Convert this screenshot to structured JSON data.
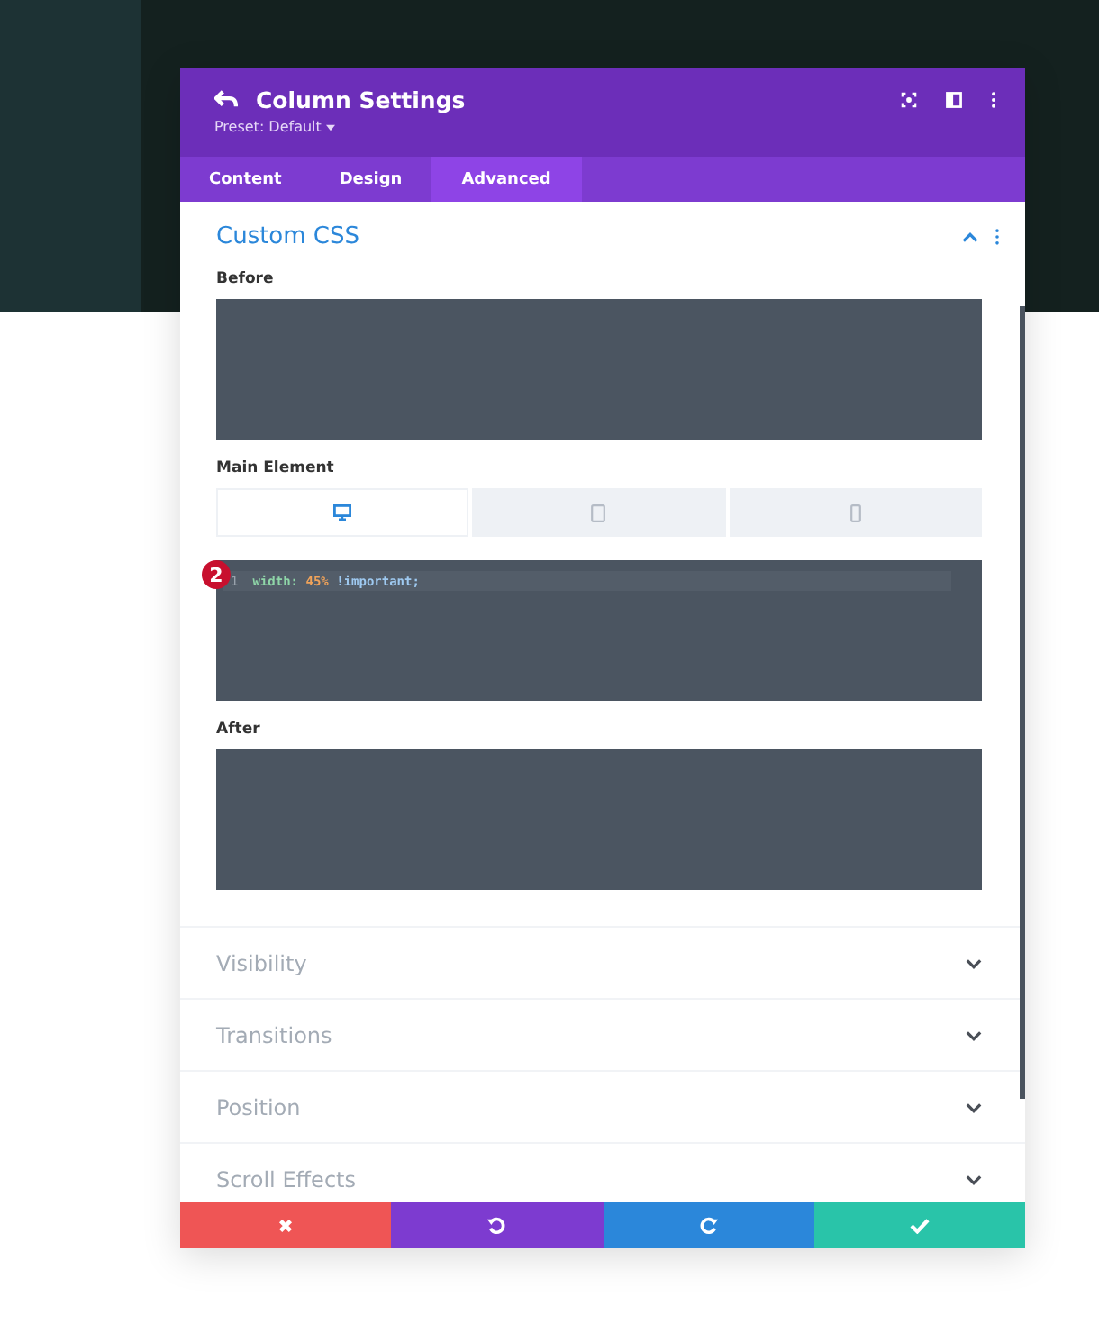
{
  "header": {
    "title": "Column Settings",
    "preset": "Preset: Default"
  },
  "tabs": [
    {
      "label": "Content",
      "selected": false
    },
    {
      "label": "Design",
      "selected": false
    },
    {
      "label": "Advanced",
      "selected": true
    }
  ],
  "section": {
    "title": "Custom CSS",
    "expanded": true
  },
  "fields": [
    {
      "label": "Before",
      "kind": "plain"
    },
    {
      "label": "Main Element",
      "kind": "code",
      "devices": [
        {
          "kind": "desktop",
          "selected": true
        },
        {
          "kind": "tablet",
          "selected": false
        },
        {
          "kind": "phone",
          "selected": false
        }
      ],
      "badge": "2",
      "line_number": "1",
      "tokens": [
        {
          "kind": "property",
          "text": "width:"
        },
        {
          "kind": "value",
          "text": "45%"
        },
        {
          "kind": "keyword",
          "text": "!important;"
        }
      ]
    },
    {
      "label": "After",
      "kind": "plain"
    }
  ],
  "collapsed_sections": [
    {
      "title": "Visibility",
      "expanded": false
    },
    {
      "title": "Transitions",
      "expanded": false
    },
    {
      "title": "Position",
      "expanded": false
    },
    {
      "title": "Scroll Effects",
      "expanded": false
    }
  ],
  "footer": [
    {
      "kind": "cancel"
    },
    {
      "kind": "undo"
    },
    {
      "kind": "redo"
    },
    {
      "kind": "save"
    }
  ]
}
